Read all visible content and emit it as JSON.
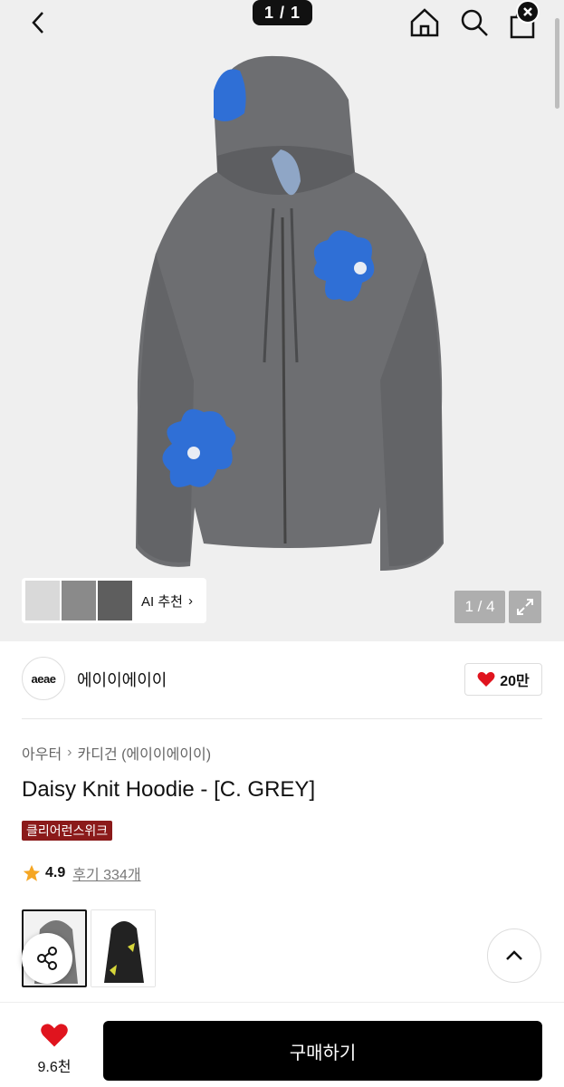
{
  "top_bar": {
    "page_indicator": "1 / 1",
    "icons": [
      "chevron-left-icon",
      "home-icon",
      "search-icon",
      "shopping-bag-icon",
      "close-icon"
    ]
  },
  "gallery": {
    "counter": "1 / 4",
    "ai_recommend_label": "AI 추천",
    "ai_chevron": "›"
  },
  "brand": {
    "logo_text": "aeae",
    "name": "에이이에이이",
    "like_count": "20만"
  },
  "breadcrumb": {
    "category": "아우터",
    "separator": "›",
    "subcategory": "카디건 (에이이에이이)"
  },
  "product": {
    "title": "Daisy Knit Hoodie - [C. GREY]",
    "tag": "클리어런스위크",
    "rating": "4.9",
    "reviews": "후기 334개"
  },
  "bottom_bar": {
    "favorite_count": "9.6천",
    "buy_label": "구매하기"
  },
  "colors": {
    "accent_red": "#e0141e",
    "tag_bg": "#8b1a1a",
    "star": "#f5a623",
    "buy_bg": "#000000"
  }
}
